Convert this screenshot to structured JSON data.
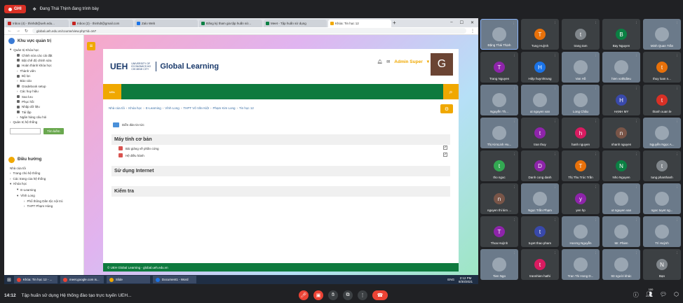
{
  "meeting": {
    "rec_label": "GHI",
    "presenter_text": "Đang Thái Thịnh đang trình bày",
    "time": "14:12",
    "title": "Tập huấn sử dụng Hệ thống đào tạo trực tuyến UEH...",
    "participants_count": "100"
  },
  "browser": {
    "tabs": [
      "Inbox (4) - thinhdt@ueh.edu...",
      "Inbox (2) - thinhdt@gmail.com",
      "Zalo Web",
      "Đăng ký tham gia tập huấn sử...",
      "Meet - Tập huấn sử dụng",
      "Khóa: Tin học 12"
    ],
    "url": "global.ueh.edu.vn/course/view.php?id=167"
  },
  "sidebar": {
    "admin_title": "Khu vực quản trị",
    "items": [
      "Quản trị Khóa học",
      "Chỉnh sửa các cài đặt",
      "Bật chế độ chỉnh sửa",
      "Hoàn thành khóa học",
      "Thành viên",
      "Bộ lọc",
      "Báo cáo",
      "Gradebook setup",
      "Các huy hiệu",
      "Sao lưu",
      "Phục hồi",
      "Nhập dữ liệu",
      "Tái lập",
      "Ngân hàng câu hỏi",
      "Quản trị hệ thống"
    ],
    "search_button": "Tìm kiếm",
    "nav_title": "Điều hướng",
    "nav_items": [
      "Nhà của tôi",
      "Trang chủ hệ thống",
      "Các trang của hệ thống",
      "Khóa học",
      "E-Learning",
      "Vĩnh Long",
      "Phổ thông Dân tộc nội trú",
      "THPT Phạm Hùng"
    ]
  },
  "header": {
    "logo": "UEH",
    "logo_small": "UNIVERSITY OF ECONOMICS HO CHI MINH CITY",
    "brand": "Global Learning",
    "user": "Admin Super",
    "avatar_letter": "G",
    "bar_logo": "UGL"
  },
  "breadcrumbs": [
    "Nhà của tôi",
    "Khóa học",
    "E-Learning",
    "Vĩnh Long",
    "THPT Võ Văn Kiệt",
    "Phạm Kim Long",
    "Tin học 12"
  ],
  "forum": "Diễn đàn tin tức",
  "sections": [
    {
      "title": "Máy tính cơ bản",
      "activities": [
        "Bài giảng về phần cứng",
        "Hệ điều hành"
      ]
    },
    {
      "title": "Sử dụng Internet",
      "activities": []
    },
    {
      "title": "Kiểm tra",
      "activities": []
    }
  ],
  "footer": "© UEH Global Learning - global.ueh.edu.vn",
  "share": {
    "text": "meet.google.com is sharing your screen.",
    "stop": "Stop sharing",
    "hide": "Hide"
  },
  "taskbar": {
    "items": [
      "Khóa: Tin học 12 - ...",
      "meet.google.com is...",
      "Slide",
      "Document1 - Word"
    ],
    "lang": "ENG",
    "clock": "2:12 PM",
    "date": "8/30/2021"
  },
  "participants": [
    {
      "name": "Đặng Thái Thịnh",
      "initial": "",
      "color": "#6b7a8a",
      "photo": true
    },
    {
      "name": "Tung Huỳnh",
      "initial": "T",
      "color": "#e8710a"
    },
    {
      "name": "trang tam",
      "initial": "t",
      "color": "#80868b"
    },
    {
      "name": "Bay Nguyen",
      "initial": "B",
      "color": "#0b8043"
    },
    {
      "name": "Minh Quan Trần",
      "initial": "",
      "color": "#6b7a8a",
      "photo": true
    },
    {
      "name": "Trang Nguyen",
      "initial": "T",
      "color": "#8e24aa"
    },
    {
      "name": "Hiệp huynhtrung",
      "initial": "H",
      "color": "#1a73e8"
    },
    {
      "name": "Van Hồ",
      "initial": "",
      "color": "#6b7a8a",
      "photo": true
    },
    {
      "name": "hien vothidieu",
      "initial": "",
      "color": "#6b7a8a",
      "photo": true
    },
    {
      "name": "thuy loan n...",
      "initial": "t",
      "color": "#e8710a"
    },
    {
      "name": "Nguyễn Th...",
      "initial": "",
      "color": "#6b7a8a",
      "photo": true
    },
    {
      "name": "ut nguyen van",
      "initial": "",
      "color": "#6b7a8a",
      "photo": true
    },
    {
      "name": "Long Châu",
      "initial": "",
      "color": "#6b7a8a",
      "photo": true
    },
    {
      "name": "HẠNH MY",
      "initial": "H",
      "color": "#3949ab"
    },
    {
      "name": "thanh xuan le",
      "initial": "t",
      "color": "#d93025"
    },
    {
      "name": "Thị KimLinh Hu...",
      "initial": "",
      "color": "#6b7a8a",
      "photo": true
    },
    {
      "name": "tran thuy",
      "initial": "t",
      "color": "#8e24aa"
    },
    {
      "name": "hanh nguyen",
      "initial": "h",
      "color": "#d81b60"
    },
    {
      "name": "nhanh nguyen",
      "initial": "n",
      "color": "#795548"
    },
    {
      "name": "Nguyễn Ngọc A...",
      "initial": "",
      "color": "#6b7a8a",
      "photo": true
    },
    {
      "name": "tho ngoc",
      "initial": "t",
      "color": "#33a852"
    },
    {
      "name": "Danh cong danh",
      "initial": "D",
      "color": "#8e24aa"
    },
    {
      "name": "Thị Thu Trúc Trần",
      "initial": "T",
      "color": "#e8710a"
    },
    {
      "name": "Nho Nguyen",
      "initial": "N",
      "color": "#0b8043"
    },
    {
      "name": "tung phanthanh",
      "initial": "t",
      "color": "#80868b"
    },
    {
      "name": "nguyen thi kim ...",
      "initial": "n",
      "color": "#795548"
    },
    {
      "name": "Ngọc Trần Phạm",
      "initial": "",
      "color": "#6b7a8a",
      "photo": true
    },
    {
      "name": "yen hp",
      "initial": "y",
      "color": "#8e24aa"
    },
    {
      "name": "ut nguyen van",
      "initial": "",
      "color": "#6b7a8a",
      "photo": true
    },
    {
      "name": "ngoc tuyet ng...",
      "initial": "",
      "color": "#6b7a8a",
      "photo": true
    },
    {
      "name": "Thoa Huỳnh",
      "initial": "T",
      "color": "#8e24aa"
    },
    {
      "name": "tuyet thao pham",
      "initial": "t",
      "color": "#3949ab"
    },
    {
      "name": "Hương Nguyễn",
      "initial": "",
      "color": "#6b7a8a",
      "photo": true
    },
    {
      "name": "Mr. Phien",
      "initial": "",
      "color": "#6b7a8a",
      "photo": true
    },
    {
      "name": "Trí Huỳnh",
      "initial": "",
      "color": "#6b7a8a",
      "photo": true
    },
    {
      "name": "Tien Ngo",
      "initial": "",
      "color": "#6b7a8a",
      "photo": true
    },
    {
      "name": "trannhien hathi",
      "initial": "t",
      "color": "#d81b60"
    },
    {
      "name": "Tran Thi Hong D...",
      "initial": "",
      "color": "#6b7a8a",
      "photo": true
    },
    {
      "name": "93 người khác",
      "initial": "",
      "color": "#6b7a8a",
      "photo": true
    },
    {
      "name": "Bạn",
      "initial": "N",
      "color": "#80868b"
    }
  ]
}
